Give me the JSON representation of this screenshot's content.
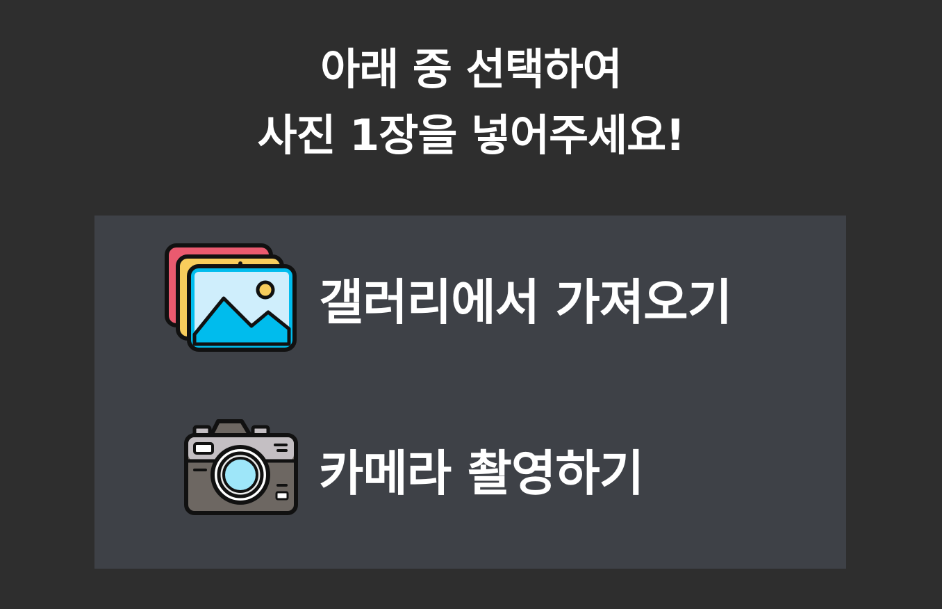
{
  "heading": {
    "line1": "아래 중 선택하여",
    "line2": "사진 1장을 넣어주세요!"
  },
  "options": [
    {
      "label": "갤러리에서 가져오기",
      "icon": "gallery-icon"
    },
    {
      "label": "카메라 촬영하기",
      "icon": "camera-icon"
    }
  ],
  "colors": {
    "background": "#2e2e2e",
    "panel": "#3e4147",
    "text": "#ffffff"
  }
}
